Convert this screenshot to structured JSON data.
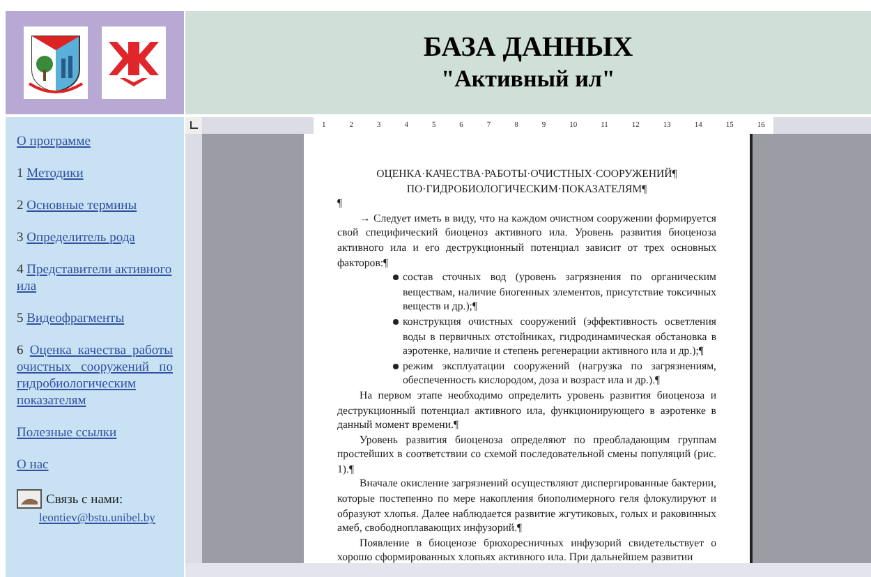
{
  "header": {
    "title": "БАЗА ДАННЫХ",
    "subtitle": "\"Активный ил\""
  },
  "sidebar": {
    "items": [
      {
        "label": "О программе"
      },
      {
        "number": "1",
        "label": "Методики"
      },
      {
        "number": "2",
        "label": "Основные термины"
      },
      {
        "number": "3",
        "label": "Определитель рода"
      },
      {
        "number": "4",
        "label": "Представители активного ила"
      },
      {
        "number": "5",
        "label": "Видеофрагменты"
      },
      {
        "number": "6",
        "label": "Оценка качества работы очистных сооружений по гидробиологическим показателям"
      },
      {
        "label": "Полезные ссылки"
      },
      {
        "label": "О нас"
      }
    ],
    "contact": {
      "label": "Связь с нами:",
      "email": "leontiev@bstu.unibel.by"
    }
  },
  "ruler": [
    "1",
    "2",
    "3",
    "4",
    "5",
    "6",
    "7",
    "8",
    "9",
    "10",
    "11",
    "12",
    "13",
    "14",
    "15",
    "16"
  ],
  "document": {
    "title": [
      "ОЦЕНКА·КАЧЕСТВА·РАБОТЫ·ОЧИСТНЫХ·СООРУЖЕНИЙ¶",
      "ПО·ГИДРОБИОЛОГИЧЕСКИМ·ПОКАЗАТЕЛЯМ¶"
    ],
    "blocks": [
      {
        "kind": "mark",
        "text": "¶"
      },
      {
        "kind": "para",
        "text": "→ Следует иметь в виду, что на каждом очистном сооружении формируется свой специфический биоценоз активного ила. Уровень развития биоценоза активного ила и его деструкционный потенциал зависит от трех основных факторов:¶"
      },
      {
        "kind": "bullet",
        "text": "состав сточных вод (уровень загрязнения по органическим веществам, наличие биогенных элементов, присутствие токсичных веществ и др.);¶"
      },
      {
        "kind": "bullet",
        "text": "конструкция очистных сооружений (эффективность осветления воды в первичных отстойниках, гидродинамическая обстановка в аэротенке, наличие и степень регенерации активного ила и др.);¶"
      },
      {
        "kind": "bullet",
        "text": "режим эксплуатации сооружений (нагрузка по загрязнениям, обеспеченность кислородом, доза и возраст ила и др.).¶"
      },
      {
        "kind": "para",
        "text": "На первом этапе необходимо определить уровень развития биоценоза и деструкционный потенциал активного ила, функционирующего в аэротенке в данный момент времени.¶"
      },
      {
        "kind": "para",
        "text": "Уровень развития биоценоза определяют по преобладающим группам простейших в соответствии со схемой последовательной смены популяций (рис. 1).¶"
      },
      {
        "kind": "para",
        "text": "Вначале окисление загрязнений осуществляют диспергированные бактерии, которые постепенно по мере накопления биополимерного геля флокулируют и образуют хлопья. Далее наблюдается развитие жгутиковых, голых и раковинных амеб, свободноплавающих инфузорий.¶"
      },
      {
        "kind": "para",
        "text": "Появление в биоценозе брюхоресничных инфузорий свидетельствует о хорошо сформированных хлопьях активного ила. При дальнейшем развитии"
      }
    ]
  }
}
